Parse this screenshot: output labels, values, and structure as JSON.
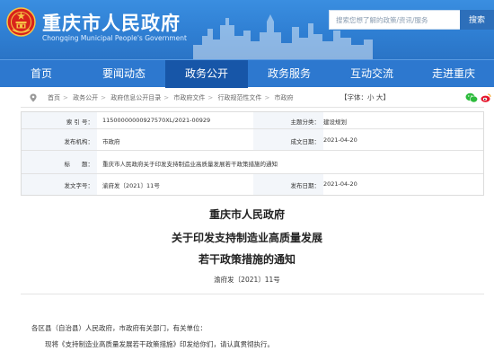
{
  "header": {
    "title": "重庆市人民政府",
    "subtitle": "Chongqing Municipal People's Government",
    "search_placeholder": "搜索您想了解的政策/资讯/服务",
    "search_button": "搜索"
  },
  "nav": {
    "items": [
      "首页",
      "要闻动态",
      "政务公开",
      "政务服务",
      "互动交流",
      "走进重庆"
    ],
    "active": "政务公开"
  },
  "breadcrumb": {
    "items": [
      "首页",
      "政务公开",
      "政府信息公开目录",
      "市政府文件",
      "行政规范性文件",
      "市政府"
    ],
    "font_size_label": "【字体：小 大】"
  },
  "meta": {
    "index_label": "索 引 号：",
    "index_value": "11500000000927570XL/2021-00929",
    "topic_label": "主题分类：",
    "topic_value": "建设规划",
    "issuer_label": "发布机构：",
    "issuer_value": "市政府",
    "created_label": "成文日期：",
    "created_value": "2021-04-20",
    "title_label": "标　　题：",
    "title_value": "重庆市人民政府关于印发支持制造业高质量发展若干政策措施的通知",
    "docno_label": "发文字号：",
    "docno_value": "渝府发〔2021〕11号",
    "published_label": "发布日期：",
    "published_value": "2021-04-20"
  },
  "document": {
    "org": "重庆市人民政府",
    "title_line1": "关于印发支持制造业高质量发展",
    "title_line2": "若干政策措施的通知",
    "doc_number": "渝府发〔2021〕11号",
    "addressee": "各区县（自治县）人民政府，市政府有关部门，有关单位：",
    "paragraph": "现将《支持制造业高质量发展若干政策措施》印发给你们，请认真贯彻执行。"
  },
  "colors": {
    "header_blue": "#2f7fd3",
    "nav_blue": "#2d78cf",
    "nav_active": "#1756a8",
    "wechat_green": "#2dbb3c",
    "weibo_red": "#e6162d"
  }
}
